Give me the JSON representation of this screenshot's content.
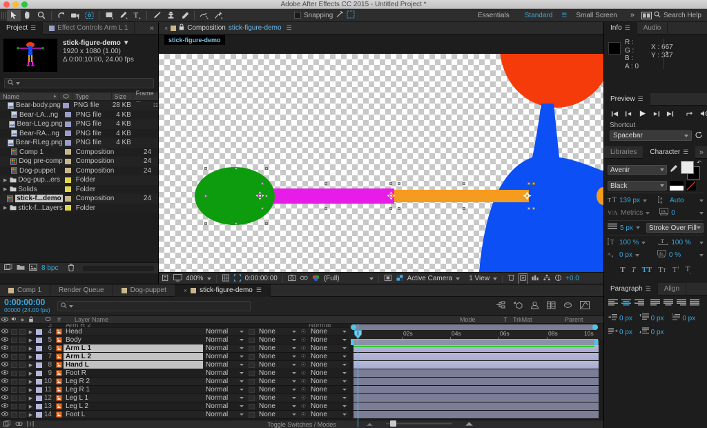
{
  "window": {
    "title": "Adobe After Effects CC 2015 - Untitled Project *"
  },
  "toolbar": {
    "tools": [
      {
        "name": "selection-tool",
        "glyph": "arrow"
      },
      {
        "name": "hand-tool",
        "glyph": "hand"
      },
      {
        "name": "zoom-tool",
        "glyph": "magnifier"
      },
      {
        "name": "rotation-tool",
        "glyph": "rotate"
      },
      {
        "name": "camera-tool",
        "glyph": "camera"
      },
      {
        "name": "pan-behind-tool",
        "glyph": "anchor"
      },
      {
        "name": "shape-tool",
        "glyph": "rect"
      },
      {
        "name": "pen-tool",
        "glyph": "pen"
      },
      {
        "name": "type-tool",
        "glyph": "type"
      },
      {
        "name": "brush-tool",
        "glyph": "brush"
      },
      {
        "name": "clone-stamp-tool",
        "glyph": "stamp"
      },
      {
        "name": "eraser-tool",
        "glyph": "eraser"
      },
      {
        "name": "roto-brush-tool",
        "glyph": "roto"
      },
      {
        "name": "puppet-pin-tool",
        "glyph": "pin"
      }
    ],
    "snapping_label": "Snapping",
    "workspaces": [
      "Essentials",
      "Standard",
      "Small Screen"
    ],
    "active_workspace": "Standard",
    "overflow_label": "»",
    "search_help_placeholder": "Search Help"
  },
  "project": {
    "tabs": [
      {
        "label": "Project",
        "active": true,
        "hamburger": true
      },
      {
        "label": "Effect Controls Arm L 1",
        "active": false,
        "swatch": "#9a9ec8"
      }
    ],
    "overflow": "»",
    "selected_item": {
      "name": "stick-figure-demo",
      "resolution": "1920 x 1080 (1.00)",
      "duration": "Δ 0:00:10:00, 24.00 fps"
    },
    "search_placeholder": "",
    "columns": [
      "Name",
      "Type",
      "Size",
      "Frame ..."
    ],
    "items": [
      {
        "name": "Bear-body.png",
        "type": "PNG file",
        "size": "28 KB",
        "frame": "",
        "color": "#9a9ec8",
        "kind": "file",
        "selected": false,
        "shared": true
      },
      {
        "name": "Bear-LA...ng",
        "type": "PNG file",
        "size": "4 KB",
        "frame": "",
        "color": "#9a9ec8",
        "kind": "file",
        "selected": false
      },
      {
        "name": "Bear-LLeg.png",
        "type": "PNG file",
        "size": "4 KB",
        "frame": "",
        "color": "#9a9ec8",
        "kind": "file",
        "selected": false
      },
      {
        "name": "Bear-RA...ng",
        "type": "PNG file",
        "size": "4 KB",
        "frame": "",
        "color": "#9a9ec8",
        "kind": "file",
        "selected": false
      },
      {
        "name": "Bear-RLeg.png",
        "type": "PNG file",
        "size": "4 KB",
        "frame": "",
        "color": "#9a9ec8",
        "kind": "file",
        "selected": false
      },
      {
        "name": "Comp 1",
        "type": "Composition",
        "size": "",
        "frame": "24",
        "color": "#c9b68c",
        "kind": "comp",
        "selected": false
      },
      {
        "name": "Dog pre-comp",
        "type": "Composition",
        "size": "",
        "frame": "24",
        "color": "#c9b68c",
        "kind": "comp",
        "selected": false
      },
      {
        "name": "Dog-puppet",
        "type": "Composition",
        "size": "",
        "frame": "24",
        "color": "#c9b68c",
        "kind": "comp",
        "selected": false
      },
      {
        "name": "Dog-pup...ers",
        "type": "Folder",
        "size": "",
        "frame": "",
        "color": "#e0d84a",
        "kind": "folder",
        "selected": false
      },
      {
        "name": "Solids",
        "type": "Folder",
        "size": "",
        "frame": "",
        "color": "#e0d84a",
        "kind": "folder",
        "selected": false
      },
      {
        "name": "stick-f...demo",
        "type": "Composition",
        "size": "",
        "frame": "24",
        "color": "#c9b68c",
        "kind": "comp",
        "selected": true
      },
      {
        "name": "stick-f...Layers",
        "type": "Folder",
        "size": "",
        "frame": "",
        "color": "#e0d84a",
        "kind": "folder",
        "selected": false
      }
    ],
    "footer": {
      "bit_depth": "8 bpc"
    }
  },
  "composition": {
    "tab_prefix": "Composition",
    "tab_name": "stick-figure-demo",
    "breadcrumb": "stick-figure-demo",
    "footer": {
      "zoom": "400%",
      "time": "0:00:00:00",
      "resolution": "(Full)",
      "camera": "Active Camera",
      "views": "1 View",
      "exposure": "+0.0"
    }
  },
  "info": {
    "tabs": [
      "Info",
      "Audio"
    ],
    "active_tab": "Info",
    "r_label": "R :",
    "r_value": "",
    "g_label": "G :",
    "g_value": "",
    "b_label": "B :",
    "b_value": "",
    "a_label": "A :",
    "a_value": "0",
    "x_label": "X :",
    "x_value": "667",
    "y_label": "Y :",
    "y_value": "347"
  },
  "preview": {
    "title": "Preview",
    "shortcut_label": "Shortcut",
    "shortcut_value": "Spacebar"
  },
  "character": {
    "tabs": [
      "Libraries",
      "Character"
    ],
    "active_tab": "Character",
    "overflow": "»",
    "font_family": "Avenir",
    "font_style": "Black",
    "font_size": "139 px",
    "leading": "Auto",
    "kerning": "Metrics",
    "tracking": "0",
    "stroke_width": "5 px",
    "stroke_order": "Stroke Over Fill",
    "vertical_scale": "100 %",
    "horizontal_scale": "100 %",
    "baseline_shift": "0 px",
    "tsume": "0 %",
    "style_buttons": [
      "T",
      "T",
      "TT",
      "Tr",
      "T1",
      "T2"
    ],
    "active_style": "TT"
  },
  "paragraph": {
    "tabs": [
      "Paragraph",
      "Align"
    ],
    "active_tab": "Paragraph",
    "indent_left": "0 px",
    "indent_right": "0 px",
    "indent_first": "0 px",
    "space_before": "0 px",
    "space_after": "0 px"
  },
  "timeline": {
    "tabs": [
      {
        "label": "Comp 1",
        "active": false,
        "swatch": "#c9b68c"
      },
      {
        "label": "Render Queue",
        "active": false,
        "swatch": null
      },
      {
        "label": "Dog-puppet",
        "active": false,
        "swatch": "#c9b68c"
      },
      {
        "label": "stick-figure-demo",
        "active": true,
        "swatch": "#c9b68c",
        "closable": true
      }
    ],
    "current_time": "0:00:00:00",
    "frame_info": "00000 (24.00 fps)",
    "search_placeholder": "",
    "columns": [
      "#",
      "Layer Name",
      "Mode",
      "T",
      "TrkMat",
      "Parent"
    ],
    "layers": [
      {
        "num": "4",
        "name": "Head",
        "mode": "Normal",
        "trkmat": "None",
        "parent": "None",
        "selected": false
      },
      {
        "num": "5",
        "name": "Body",
        "mode": "Normal",
        "trkmat": "None",
        "parent": "None",
        "selected": false
      },
      {
        "num": "6",
        "name": "Arm L 1",
        "mode": "Normal",
        "trkmat": "None",
        "parent": "None",
        "selected": true
      },
      {
        "num": "7",
        "name": "Arm L 2",
        "mode": "Normal",
        "trkmat": "None",
        "parent": "None",
        "selected": true
      },
      {
        "num": "8",
        "name": "Hand L",
        "mode": "Normal",
        "trkmat": "None",
        "parent": "None",
        "selected": true
      },
      {
        "num": "9",
        "name": "Foot R",
        "mode": "Normal",
        "trkmat": "None",
        "parent": "None",
        "selected": false
      },
      {
        "num": "10",
        "name": "Leg R 2",
        "mode": "Normal",
        "trkmat": "None",
        "parent": "None",
        "selected": false
      },
      {
        "num": "11",
        "name": "Leg R 1",
        "mode": "Normal",
        "trkmat": "None",
        "parent": "None",
        "selected": false
      },
      {
        "num": "12",
        "name": "Leg L 1",
        "mode": "Normal",
        "trkmat": "None",
        "parent": "None",
        "selected": false
      },
      {
        "num": "13",
        "name": "Leg L 2",
        "mode": "Normal",
        "trkmat": "None",
        "parent": "None",
        "selected": false
      },
      {
        "num": "14",
        "name": "Foot L",
        "mode": "Normal",
        "trkmat": "None",
        "parent": "None",
        "selected": false
      }
    ],
    "ruler_labels": [
      "0s",
      "02s",
      "04s",
      "06s",
      "08s",
      "10s"
    ],
    "footer_label": "Toggle Switches / Modes"
  },
  "canvas_art": {
    "hand_color": "#0d9c0d",
    "arm_lower_color": "#e81ce8",
    "arm_upper_color": "#f59b1e",
    "head_color": "#f53b0a",
    "body_color": "#0b4ff5"
  },
  "colors": {
    "accent": "#37a9e0",
    "panel_bg": "#1d1d1d",
    "tab_bg": "#2b2b2b",
    "selection": "#c2c2c2"
  }
}
